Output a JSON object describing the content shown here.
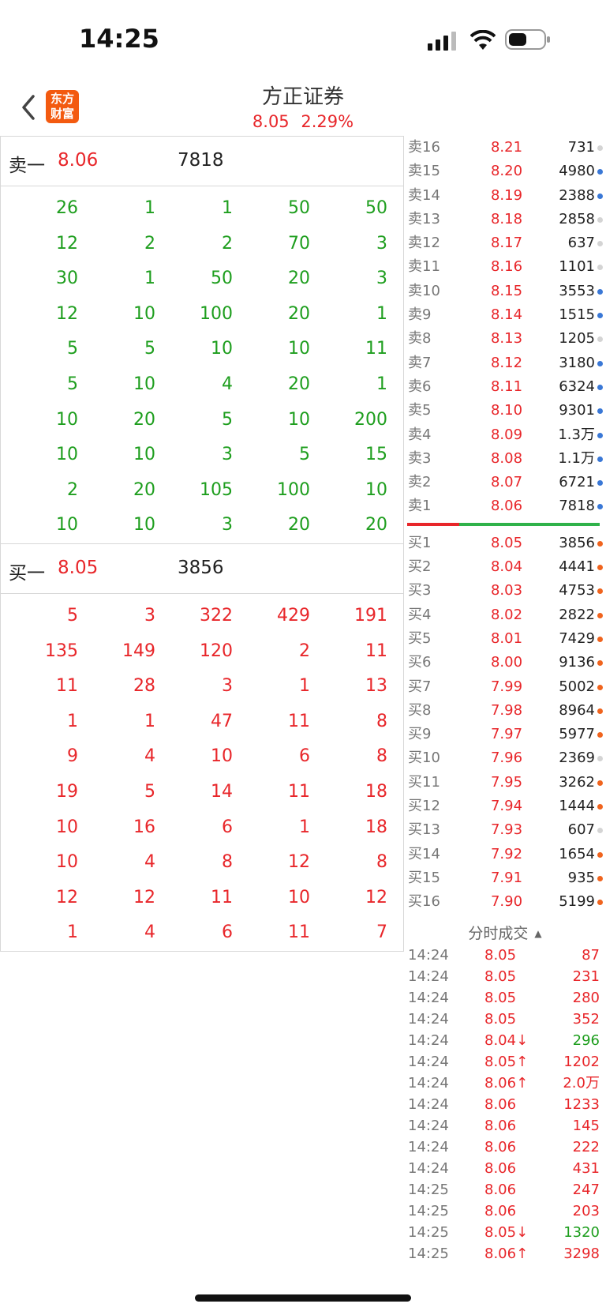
{
  "status": {
    "time": "14:25"
  },
  "header": {
    "logo_line1": "东方",
    "logo_line2": "财富",
    "title": "方正证券",
    "price": "8.05",
    "change_pct": "2.29%"
  },
  "sell1": {
    "label": "卖一",
    "price": "8.06",
    "volume": "7818"
  },
  "buy1": {
    "label": "买一",
    "price": "8.05",
    "volume": "3856"
  },
  "sell_queue": [
    [
      "26",
      "1",
      "1",
      "50",
      "50"
    ],
    [
      "12",
      "2",
      "2",
      "70",
      "3"
    ],
    [
      "30",
      "1",
      "50",
      "20",
      "3"
    ],
    [
      "12",
      "10",
      "100",
      "20",
      "1"
    ],
    [
      "5",
      "5",
      "10",
      "10",
      "11"
    ],
    [
      "5",
      "10",
      "4",
      "20",
      "1"
    ],
    [
      "10",
      "20",
      "5",
      "10",
      "200"
    ],
    [
      "10",
      "10",
      "3",
      "5",
      "15"
    ],
    [
      "2",
      "20",
      "105",
      "100",
      "10"
    ],
    [
      "10",
      "10",
      "3",
      "20",
      "20"
    ]
  ],
  "buy_queue": [
    [
      "5",
      "3",
      "322",
      "429",
      "191"
    ],
    [
      "135",
      "149",
      "120",
      "2",
      "11"
    ],
    [
      "11",
      "28",
      "3",
      "1",
      "13"
    ],
    [
      "1",
      "1",
      "47",
      "11",
      "8"
    ],
    [
      "9",
      "4",
      "10",
      "6",
      "8"
    ],
    [
      "19",
      "5",
      "14",
      "11",
      "18"
    ],
    [
      "10",
      "16",
      "6",
      "1",
      "18"
    ],
    [
      "10",
      "4",
      "8",
      "12",
      "8"
    ],
    [
      "12",
      "12",
      "11",
      "10",
      "12"
    ],
    [
      "1",
      "4",
      "6",
      "11",
      "7"
    ]
  ],
  "colors": {
    "up": "#e8262a",
    "down": "#1e9e1e",
    "dot_blue": "#3a78d6",
    "dot_gray": "#d4d4d4",
    "dot_orange": "#f0641e"
  },
  "asks": [
    {
      "label": "卖16",
      "price": "8.21",
      "vol": "731",
      "dot": "gray"
    },
    {
      "label": "卖15",
      "price": "8.20",
      "vol": "4980",
      "dot": "blue"
    },
    {
      "label": "卖14",
      "price": "8.19",
      "vol": "2388",
      "dot": "blue"
    },
    {
      "label": "卖13",
      "price": "8.18",
      "vol": "2858",
      "dot": "gray"
    },
    {
      "label": "卖12",
      "price": "8.17",
      "vol": "637",
      "dot": "gray"
    },
    {
      "label": "卖11",
      "price": "8.16",
      "vol": "1101",
      "dot": "gray"
    },
    {
      "label": "卖10",
      "price": "8.15",
      "vol": "3553",
      "dot": "blue"
    },
    {
      "label": "卖9",
      "price": "8.14",
      "vol": "1515",
      "dot": "blue"
    },
    {
      "label": "卖8",
      "price": "8.13",
      "vol": "1205",
      "dot": "gray"
    },
    {
      "label": "卖7",
      "price": "8.12",
      "vol": "3180",
      "dot": "blue"
    },
    {
      "label": "卖6",
      "price": "8.11",
      "vol": "6324",
      "dot": "blue"
    },
    {
      "label": "卖5",
      "price": "8.10",
      "vol": "9301",
      "dot": "blue"
    },
    {
      "label": "卖4",
      "price": "8.09",
      "vol": "1.3万",
      "dot": "blue"
    },
    {
      "label": "卖3",
      "price": "8.08",
      "vol": "1.1万",
      "dot": "blue"
    },
    {
      "label": "卖2",
      "price": "8.07",
      "vol": "6721",
      "dot": "blue"
    },
    {
      "label": "卖1",
      "price": "8.06",
      "vol": "7818",
      "dot": "blue"
    }
  ],
  "bids": [
    {
      "label": "买1",
      "price": "8.05",
      "vol": "3856",
      "dot": "orange"
    },
    {
      "label": "买2",
      "price": "8.04",
      "vol": "4441",
      "dot": "orange"
    },
    {
      "label": "买3",
      "price": "8.03",
      "vol": "4753",
      "dot": "orange"
    },
    {
      "label": "买4",
      "price": "8.02",
      "vol": "2822",
      "dot": "orange"
    },
    {
      "label": "买5",
      "price": "8.01",
      "vol": "7429",
      "dot": "orange"
    },
    {
      "label": "买6",
      "price": "8.00",
      "vol": "9136",
      "dot": "orange"
    },
    {
      "label": "买7",
      "price": "7.99",
      "vol": "5002",
      "dot": "orange"
    },
    {
      "label": "买8",
      "price": "7.98",
      "vol": "8964",
      "dot": "orange"
    },
    {
      "label": "买9",
      "price": "7.97",
      "vol": "5977",
      "dot": "orange"
    },
    {
      "label": "买10",
      "price": "7.96",
      "vol": "2369",
      "dot": "gray"
    },
    {
      "label": "买11",
      "price": "7.95",
      "vol": "3262",
      "dot": "orange"
    },
    {
      "label": "买12",
      "price": "7.94",
      "vol": "1444",
      "dot": "orange"
    },
    {
      "label": "买13",
      "price": "7.93",
      "vol": "607",
      "dot": "gray"
    },
    {
      "label": "买14",
      "price": "7.92",
      "vol": "1654",
      "dot": "orange"
    },
    {
      "label": "买15",
      "price": "7.91",
      "vol": "935",
      "dot": "orange"
    },
    {
      "label": "买16",
      "price": "7.90",
      "vol": "5199",
      "dot": "orange"
    }
  ],
  "ticks_title": "分时成交",
  "ticks": [
    {
      "time": "14:24",
      "price": "8.05",
      "vol": "87",
      "dir": "up"
    },
    {
      "time": "14:24",
      "price": "8.05",
      "vol": "231",
      "dir": "up"
    },
    {
      "time": "14:24",
      "price": "8.05",
      "vol": "280",
      "dir": "up"
    },
    {
      "time": "14:24",
      "price": "8.05",
      "vol": "352",
      "dir": "up"
    },
    {
      "time": "14:24",
      "price": "8.04↓",
      "vol": "296",
      "dir": "down"
    },
    {
      "time": "14:24",
      "price": "8.05↑",
      "vol": "1202",
      "dir": "up"
    },
    {
      "time": "14:24",
      "price": "8.06↑",
      "vol": "2.0万",
      "dir": "up"
    },
    {
      "time": "14:24",
      "price": "8.06",
      "vol": "1233",
      "dir": "up"
    },
    {
      "time": "14:24",
      "price": "8.06",
      "vol": "145",
      "dir": "up"
    },
    {
      "time": "14:24",
      "price": "8.06",
      "vol": "222",
      "dir": "up"
    },
    {
      "time": "14:24",
      "price": "8.06",
      "vol": "431",
      "dir": "up"
    },
    {
      "time": "14:25",
      "price": "8.06",
      "vol": "247",
      "dir": "up"
    },
    {
      "time": "14:25",
      "price": "8.06",
      "vol": "203",
      "dir": "up"
    },
    {
      "time": "14:25",
      "price": "8.05↓",
      "vol": "1320",
      "dir": "down"
    },
    {
      "time": "14:25",
      "price": "8.06↑",
      "vol": "3298",
      "dir": "up"
    }
  ]
}
